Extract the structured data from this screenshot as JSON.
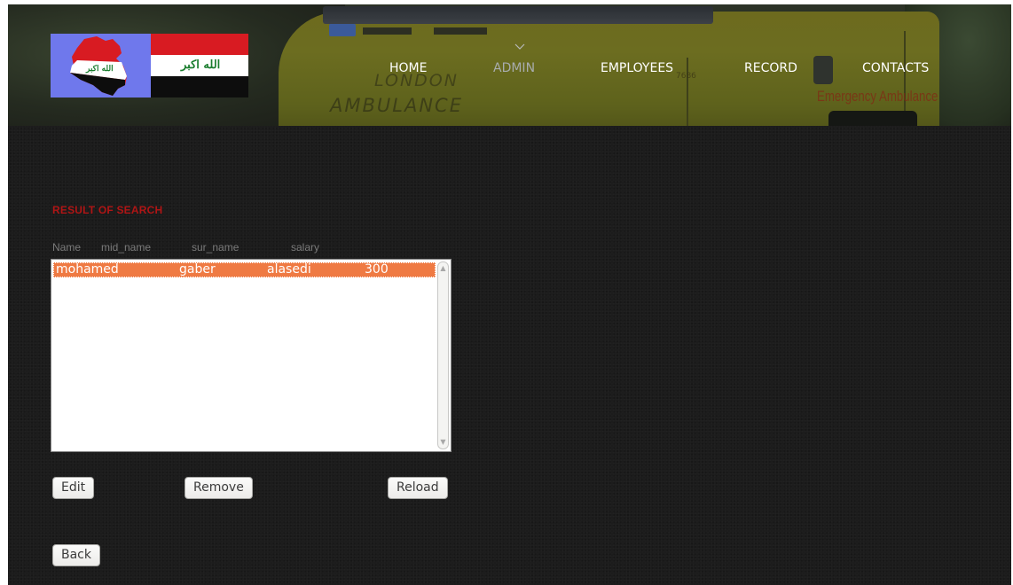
{
  "nav": {
    "items": [
      {
        "label": "HOME",
        "active": false
      },
      {
        "label": "ADMIN",
        "active": true
      },
      {
        "label": "EMPLOYEES",
        "active": false
      },
      {
        "label": "RECORD",
        "active": false
      },
      {
        "label": "CONTACTS",
        "active": false
      }
    ]
  },
  "header": {
    "image_text_london": "LONDON",
    "image_text_ambulance": "AMBULANCE",
    "image_text_emergency": "Emergency Ambulance",
    "image_text_number": "7686",
    "logo_flag_script": "الله اكبر",
    "logo_map_script": "الله اكبر"
  },
  "search_result": {
    "title": "RESULT OF SEARCH",
    "columns": [
      "Name",
      "mid_name",
      "sur_name",
      "salary"
    ],
    "rows": [
      {
        "name": "mohamed",
        "mid_name": "gaber",
        "sur_name": "alasedi",
        "salary": "300",
        "selected": true
      }
    ]
  },
  "buttons": {
    "edit": "Edit",
    "remove": "Remove",
    "reload": "Reload",
    "back": "Back"
  },
  "colors": {
    "page_bg": "#1c1c1c",
    "title_red": "#b01515",
    "selection_orange": "#ef7a43",
    "nav_text": "#ffffff",
    "nav_active": "#a8acad"
  },
  "icons": {
    "nav_caret": "chevron-down-icon",
    "scroll_up": "arrow-up-icon",
    "scroll_down": "arrow-down-icon"
  }
}
